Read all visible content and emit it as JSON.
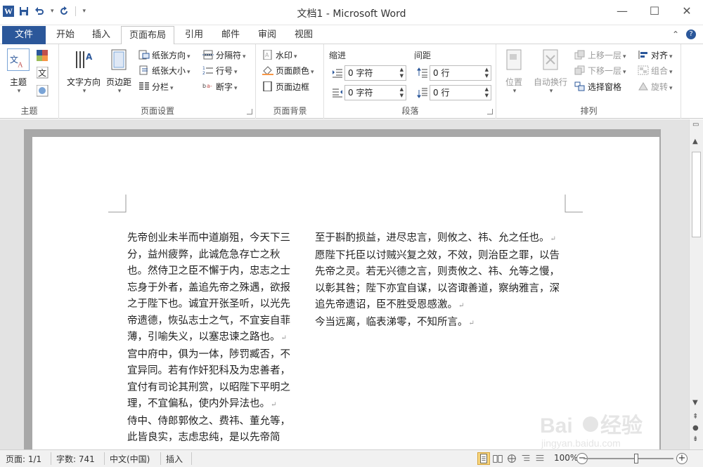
{
  "titlebar": {
    "app_icon": "W",
    "title": "文档1 - Microsoft Word",
    "qat_icons": [
      "save-icon",
      "undo-icon",
      "redo-icon",
      "customize-icon"
    ],
    "controls": {
      "minimize": "—",
      "maximize": "☐",
      "close": "✕"
    }
  },
  "tabs": {
    "file": "文件",
    "items": [
      "开始",
      "插入",
      "页面布局",
      "引用",
      "邮件",
      "审阅",
      "视图"
    ],
    "active": "页面布局"
  },
  "ribbon": {
    "theme": {
      "label": "主题",
      "button": "主题"
    },
    "page_setup": {
      "label": "页面设置",
      "text_direction": "文字方向",
      "margins": "页边距",
      "orientation": "纸张方向",
      "size": "纸张大小",
      "columns": "分栏",
      "breaks": "分隔符",
      "line_numbers": "行号",
      "hyphenation": "断字"
    },
    "page_background": {
      "label": "页面背景",
      "watermark": "水印",
      "page_color": "页面颜色",
      "page_borders": "页面边框"
    },
    "paragraph": {
      "label": "段落",
      "indent_label": "缩进",
      "spacing_label": "间距",
      "indent_left": "0 字符",
      "indent_right": "0 字符",
      "spacing_before": "0 行",
      "spacing_after": "0 行"
    },
    "arrange": {
      "label": "排列",
      "position": "位置",
      "wrap_text": "自动换行",
      "bring_forward": "上移一层",
      "send_backward": "下移一层",
      "selection_pane": "选择窗格",
      "align": "对齐",
      "group": "组合",
      "rotate": "旋转"
    }
  },
  "document": {
    "col1_paragraphs": [
      "先帝创业未半而中道崩殂，今天下三分，益州疲弊，此诚危急存亡之秋也。然侍卫之臣不懈于内，忠志之士忘身于外者，盖追先帝之殊遇，欲报之于陛下也。诚宜开张圣听，以光先帝遗德，恢弘志士之气，不宜妄自菲薄，引喻失义，以塞忠谏之路也。",
      "宫中府中，俱为一体，陟罚臧否，不宜异同。若有作奸犯科及为忠善者，宜付有司论其刑赏，以昭陛下平明之理，不宜偏私，使内外异法也。",
      "侍中、侍郎郭攸之、费祎、董允等，此皆良实，志虑忠纯，是以先帝简"
    ],
    "col2_paragraphs": [
      "至于斟酌损益，进尽忠言，则攸之、祎、允之任也。",
      "愿陛下托臣以讨贼兴复之效，不效，则治臣之罪，以告先帝之灵。若无兴德之言，则责攸之、祎、允等之慢，以彰其咎；陛下亦宜自谋，以咨诹善道，察纳雅言，深追先帝遗诏，臣不胜受恩感激。",
      "今当远离，临表涕零，不知所言。"
    ],
    "pilcrow": "↵"
  },
  "statusbar": {
    "page": "页面: 1/1",
    "words": "字数: 741",
    "language": "中文(中国)",
    "mode": "插入",
    "zoom": "100%",
    "zoom_out": "−",
    "zoom_in": "+"
  },
  "watermark": {
    "text": "Baidu经验",
    "sub": "jingyan.baidu.com"
  },
  "colors": {
    "brand": "#2b579a",
    "ribbon_bg": "#ffffff",
    "doc_bg": "#e3e3e3",
    "active_view": "#f6d47d"
  }
}
